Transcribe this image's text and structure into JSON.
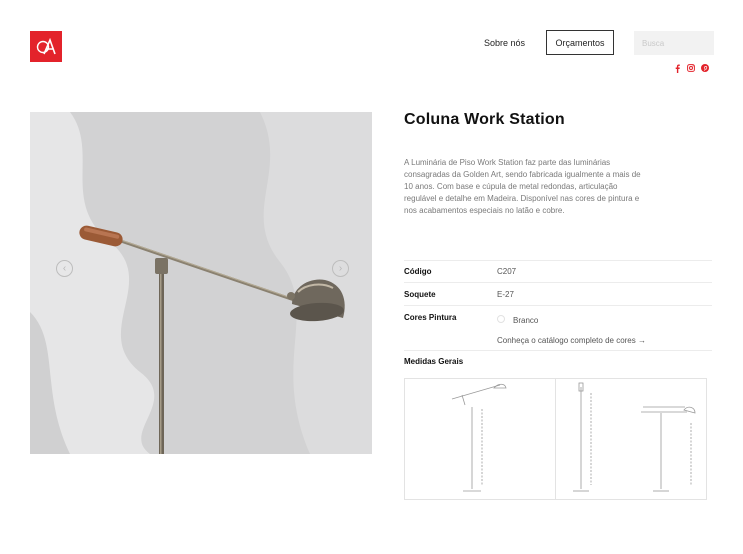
{
  "header": {
    "nav": {
      "about": "Sobre nós",
      "quotes": "Orçamentos"
    },
    "search": {
      "placeholder": "Busca"
    },
    "social": [
      "facebook-icon",
      "instagram-icon",
      "pinterest-icon"
    ]
  },
  "product": {
    "title": "Coluna Work Station",
    "description": "A Luminária de Piso Work Station faz parte das luminárias consagradas da Golden Art, sendo fabricada igualmente a mais de 10 anos. Com base e cúpula de metal redondas, articulação regulável e detalhe em Madeira. Disponível nas cores de pintura e nos acabamentos especiais no latão e cobre.",
    "specs": {
      "code_label": "Código",
      "code_value": "C207",
      "socket_label": "Soquete",
      "socket_value": "E-27",
      "colors_label": "Cores Pintura",
      "color_option": "Branco",
      "catalog_link": "Conheça o catálogo completo de cores →",
      "measures_label": "Medidas Gerais"
    }
  },
  "gallery": {
    "prev_icon": "chevron-left-icon",
    "next_icon": "chevron-right-icon"
  },
  "colors": {
    "brand": "#e3232b",
    "text": "#1f1f1f",
    "muted": "#7a7a7a",
    "photo_bg": "#d9d9da"
  }
}
